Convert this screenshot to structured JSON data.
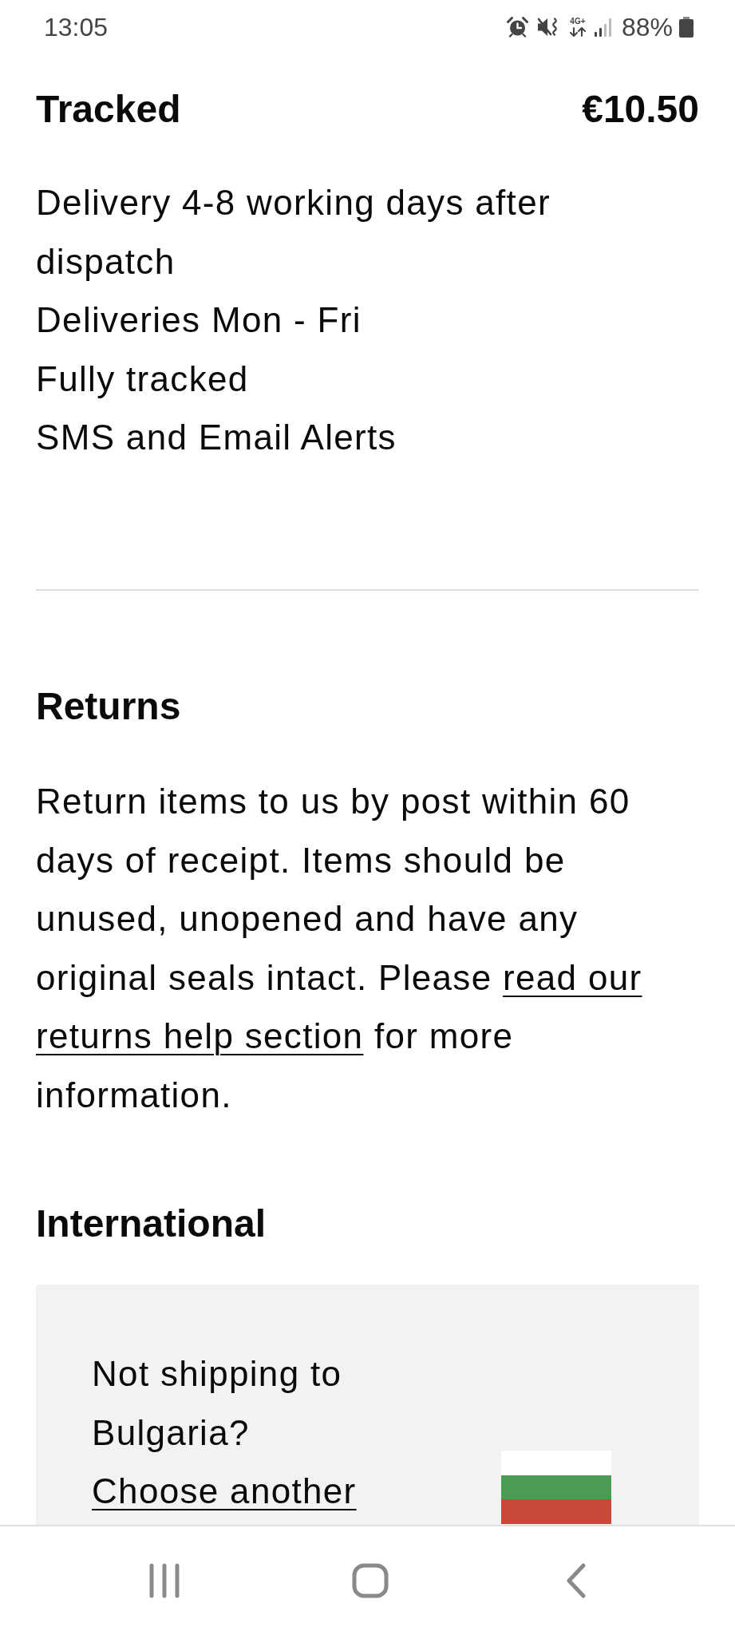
{
  "status_bar": {
    "time": "13:05",
    "network_type": "4G+",
    "battery": "88%"
  },
  "shipping_option": {
    "name": "Tracked",
    "price": "€10.50",
    "features": [
      "Delivery 4-8 working days after dispatch",
      "Deliveries Mon - Fri",
      "Fully tracked",
      "SMS and Email Alerts"
    ]
  },
  "returns": {
    "title": "Returns",
    "body": [
      {
        "kind": "text",
        "text": "Return items to us by post within 60 days of receipt. Items should be unused, unopened and have any original seals intact. Please "
      },
      {
        "kind": "link",
        "text": "read our "
      },
      {
        "kind": "link",
        "text": "returns help section"
      },
      {
        "kind": "text",
        "text": " for more information."
      }
    ]
  },
  "international": {
    "title": "International",
    "question": "Not shipping to Bulgaria?",
    "link": "Choose another"
  }
}
